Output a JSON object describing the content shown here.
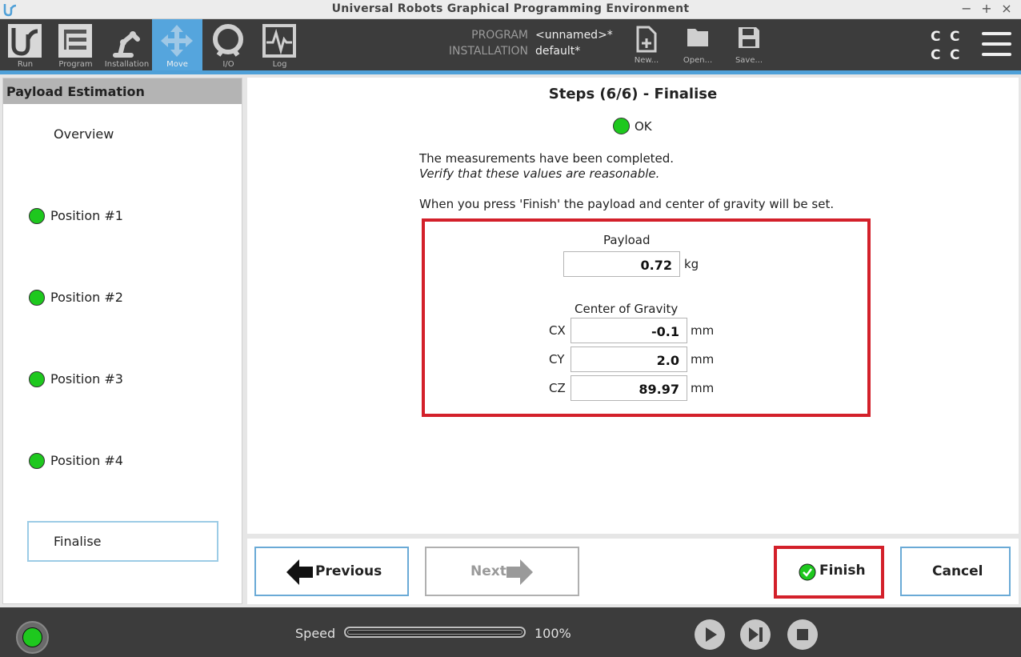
{
  "window": {
    "title": "Universal Robots Graphical Programming Environment",
    "controls": [
      "−",
      "+",
      "×"
    ]
  },
  "toolbar": {
    "nav": [
      {
        "id": "run",
        "label": "Run",
        "icon": "ur-logo-icon"
      },
      {
        "id": "program",
        "label": "Program",
        "icon": "program-icon"
      },
      {
        "id": "installation",
        "label": "Installation",
        "icon": "robot-arm-icon"
      },
      {
        "id": "move",
        "label": "Move",
        "icon": "move-arrows-icon",
        "active": true
      },
      {
        "id": "io",
        "label": "I/O",
        "icon": "io-icon"
      },
      {
        "id": "log",
        "label": "Log",
        "icon": "log-icon"
      }
    ],
    "program_key": "PROGRAM",
    "program_value": "<unnamed>*",
    "installation_key": "INSTALLATION",
    "installation_value": "default*",
    "file": [
      {
        "id": "new",
        "label": "New..."
      },
      {
        "id": "open",
        "label": "Open..."
      },
      {
        "id": "save",
        "label": "Save..."
      }
    ],
    "cc": [
      "C",
      "C",
      "C",
      "C"
    ]
  },
  "sidebar": {
    "header": "Payload Estimation",
    "items": [
      {
        "label": "Overview",
        "done": false
      },
      {
        "label": "Position #1",
        "done": true
      },
      {
        "label": "Position #2",
        "done": true
      },
      {
        "label": "Position #3",
        "done": true
      },
      {
        "label": "Position #4",
        "done": true
      },
      {
        "label": "Finalise",
        "done": false,
        "selected": true
      }
    ]
  },
  "main": {
    "title": "Steps (6/6) - Finalise",
    "status": "OK",
    "message1": "The measurements have been completed.",
    "message2": "Verify that these values are reasonable.",
    "message3": "When you press 'Finish' the payload and center of gravity will be set.",
    "payload": {
      "label": "Payload",
      "value": "0.72",
      "unit": "kg"
    },
    "cog": {
      "label": "Center of Gravity",
      "cx": {
        "label": "CX",
        "value": "-0.1",
        "unit": "mm"
      },
      "cy": {
        "label": "CY",
        "value": "2.0",
        "unit": "mm"
      },
      "cz": {
        "label": "CZ",
        "value": "89.97",
        "unit": "mm"
      }
    }
  },
  "buttons": {
    "previous": "Previous",
    "next": "Next",
    "finish": "Finish",
    "cancel": "Cancel"
  },
  "footer": {
    "speed_label": "Speed",
    "speed_value": "100%",
    "speed_fraction": 1.0
  },
  "colors": {
    "accent": "#55a5dd",
    "ok_green": "#1ec81e",
    "highlight_red": "#d3202a"
  }
}
